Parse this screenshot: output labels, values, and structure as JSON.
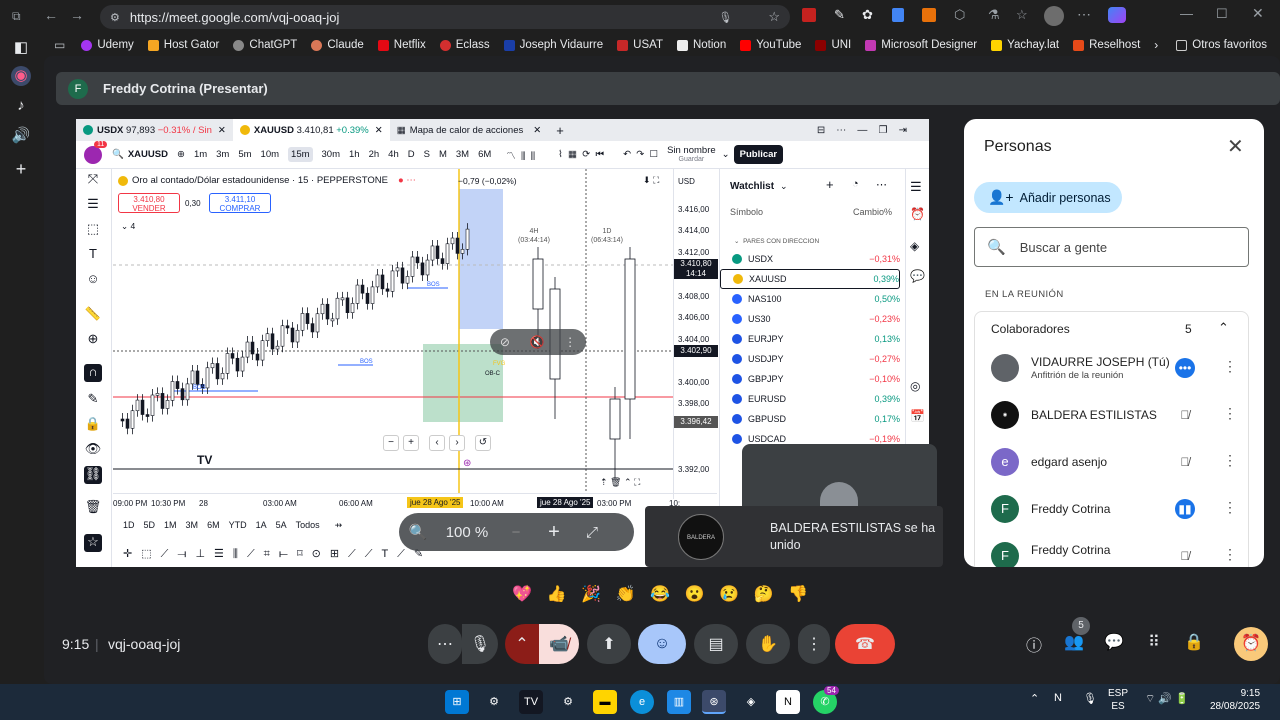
{
  "browser": {
    "url": "https://meet.google.com/vqj-ooaq-joj",
    "bookmarks": [
      "Udemy",
      "Host Gator",
      "ChatGPT",
      "Claude",
      "Netflix",
      "Eclass",
      "Joseph Vidaurre",
      "USAT",
      "Notion",
      "YouTube",
      "UNI",
      "Microsoft Designer",
      "Yachay.lat",
      "Reselhost"
    ],
    "other_favorites": "Otros favoritos"
  },
  "meet": {
    "presenter_initial": "F",
    "presenter_label": "Freddy Cotrina (Presentar)",
    "time": "9:15",
    "meeting_code": "vqj-ooaq-joj",
    "participants_badge": "5"
  },
  "tradingview": {
    "tabs": [
      {
        "symbol": "USDX",
        "price": "97,893",
        "change": "−0.31% / Sin"
      },
      {
        "symbol": "XAUUSD",
        "price": "3.410,81",
        "change": "+0.39%"
      },
      {
        "symbol": "Mapa de calor de acciones",
        "price": "",
        "change": ""
      }
    ],
    "toolbar": {
      "symbol": "XAUUSD",
      "timeframes": [
        "1m",
        "3m",
        "5m",
        "10m",
        "15m",
        "30m",
        "1h",
        "2h",
        "4h",
        "D",
        "S",
        "M",
        "3M",
        "6M"
      ],
      "layout_name": "Sin nombre",
      "layout_sub": "Guardar",
      "publish": "Publicar",
      "notif_badge": "11"
    },
    "legend": {
      "title": "Oro al contado/Dólar estadounidense · 15 · PEPPERSTONE",
      "sell_price": "3.410,80",
      "sell_label": "VENDER",
      "spread": "0,30",
      "buy_price": "3.411,10",
      "buy_label": "COMPRAR",
      "indicators_count": "4",
      "change_readout": "−0,79 (−0,02%)"
    },
    "annotations": {
      "bos_1": "BOS",
      "bos_2": "BOS",
      "bos_3": "BOS",
      "ob": "OB-C",
      "fvg": "FVG",
      "tf_4h": "4H",
      "tf_4h_countdown": "(03:44:14)",
      "tf_1d": "1D",
      "tf_1d_countdown": "(06:43:14)"
    },
    "price_axis": {
      "currency": "USD",
      "ticks": [
        "3.416,00",
        "3.414,00",
        "3.412,00",
        "3.408,00",
        "3.406,00",
        "3.404,00",
        "3.400,00",
        "3.398,00",
        "3.392,00"
      ],
      "last_price": "3.410,80",
      "last_countdown": "14:14",
      "cross_price": "3.402,90",
      "low_price": "3.396,42"
    },
    "time_axis": {
      "ticks": [
        "09:00 PM",
        "10:30 PM",
        "28",
        "03:00 AM",
        "06:00 AM",
        "10:00 AM",
        "03:00 PM",
        "10:"
      ],
      "highlight_1": "jue 28 Ago '25",
      "highlight_2": "jue 28 Ago '25"
    },
    "ranges": [
      "1D",
      "5D",
      "1M",
      "3M",
      "6M",
      "YTD",
      "1A",
      "5A",
      "Todos"
    ],
    "watchlist": {
      "title": "Watchlist",
      "col_symbol": "Símbolo",
      "col_change": "Cambio%",
      "section": "PARES CON DIRECCION",
      "rows": [
        {
          "sym": "USDX",
          "chg": "−0,31%",
          "dir": "neg",
          "color": "#089981"
        },
        {
          "sym": "XAUUSD",
          "chg": "0,39%",
          "dir": "pos",
          "color": "#f0b90b"
        },
        {
          "sym": "NAS100",
          "chg": "0,50%",
          "dir": "pos",
          "color": "#2962ff"
        },
        {
          "sym": "US30",
          "chg": "−0,23%",
          "dir": "neg",
          "color": "#2962ff"
        },
        {
          "sym": "EURJPY",
          "chg": "0,13%",
          "dir": "pos",
          "color": "#1e53e5"
        },
        {
          "sym": "USDJPY",
          "chg": "−0,27%",
          "dir": "neg",
          "color": "#1e53e5"
        },
        {
          "sym": "GBPJPY",
          "chg": "−0,10%",
          "dir": "neg",
          "color": "#1e53e5"
        },
        {
          "sym": "EURUSD",
          "chg": "0,39%",
          "dir": "pos",
          "color": "#1e53e5"
        },
        {
          "sym": "GBPUSD",
          "chg": "0,17%",
          "dir": "pos",
          "color": "#1e53e5"
        },
        {
          "sym": "USDCAD",
          "chg": "−0,19%",
          "dir": "neg",
          "color": "#1e53e5"
        }
      ]
    }
  },
  "zoom": {
    "value": "100 %"
  },
  "people": {
    "title": "Personas",
    "add_label": "Añadir personas",
    "search_placeholder": "Buscar a gente",
    "section": "EN LA REUNIÓN",
    "group": "Colaboradores",
    "group_count": "5",
    "rows": [
      {
        "name": "VIDAURRE JOSEPH (Tú)",
        "sub": "Anfitrión de la reunión",
        "initial": "",
        "color": "#5f6368"
      },
      {
        "name": "BALDERA ESTILISTAS",
        "sub": "",
        "initial": "",
        "color": "#111111"
      },
      {
        "name": "edgard asenjo",
        "sub": "",
        "initial": "e",
        "color": "#7b68c8"
      },
      {
        "name": "Freddy Cotrina",
        "sub": "",
        "initial": "F",
        "color": "#1e6b4c"
      },
      {
        "name": "Freddy Cotrina",
        "sub": "",
        "initial": "F",
        "color": "#1e6b4c"
      }
    ]
  },
  "toast": {
    "text": "BALDERA ESTILISTAS se ha unido",
    "logo_text": "BALDERA"
  },
  "reactions": [
    "💖",
    "👍",
    "🎉",
    "👏",
    "😂",
    "😮",
    "😢",
    "🤔",
    "👎"
  ],
  "taskbar": {
    "lang_1": "ESP",
    "lang_2": "ES",
    "time": "9:15",
    "date": "28/08/2025",
    "whatsapp_badge": "54"
  },
  "colors": {
    "meet_bg": "#202124",
    "end_call": "#ea4335",
    "accent_blue": "#1a73e8",
    "tv_red": "#f23645",
    "tv_green": "#089981"
  }
}
